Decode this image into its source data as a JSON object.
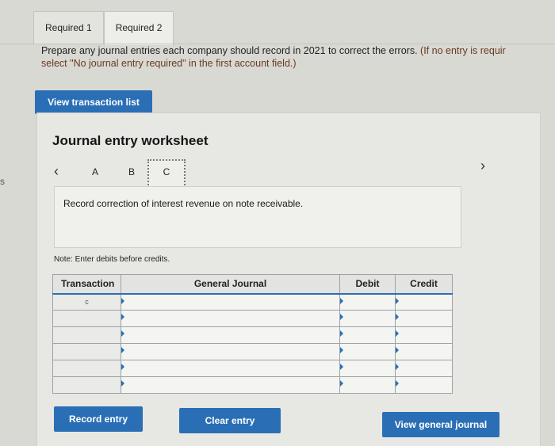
{
  "tabs": [
    {
      "label": "Required 1"
    },
    {
      "label": "Required 2"
    }
  ],
  "instructions": {
    "main": "Prepare any journal entries each company should record in 2021 to correct the errors.",
    "paren": " (If no entry is requir",
    "line2_prefix": "select \"No journal entry required\" in the first account field.)"
  },
  "buttons": {
    "view_transaction_list": "View transaction list",
    "record_entry": "Record entry",
    "clear_entry": "Clear entry",
    "view_general_journal": "View general journal"
  },
  "worksheet": {
    "title": "Journal entry worksheet",
    "nav_letters": [
      "A",
      "B",
      "C"
    ],
    "prev_icon": "‹",
    "next_icon": "›",
    "description": "Record correction of interest revenue on note receivable.",
    "note": "Note: Enter debits before credits."
  },
  "journal_table": {
    "headers": {
      "transaction": "Transaction",
      "general_journal": "General Journal",
      "debit": "Debit",
      "credit": "Credit"
    },
    "rows": [
      {
        "transaction": "c"
      },
      {
        "transaction": ""
      },
      {
        "transaction": ""
      },
      {
        "transaction": ""
      },
      {
        "transaction": ""
      },
      {
        "transaction": ""
      }
    ]
  },
  "edge_letter": "s",
  "colors": {
    "accent": "#2a6fb5",
    "background": "#d9d9d4"
  }
}
